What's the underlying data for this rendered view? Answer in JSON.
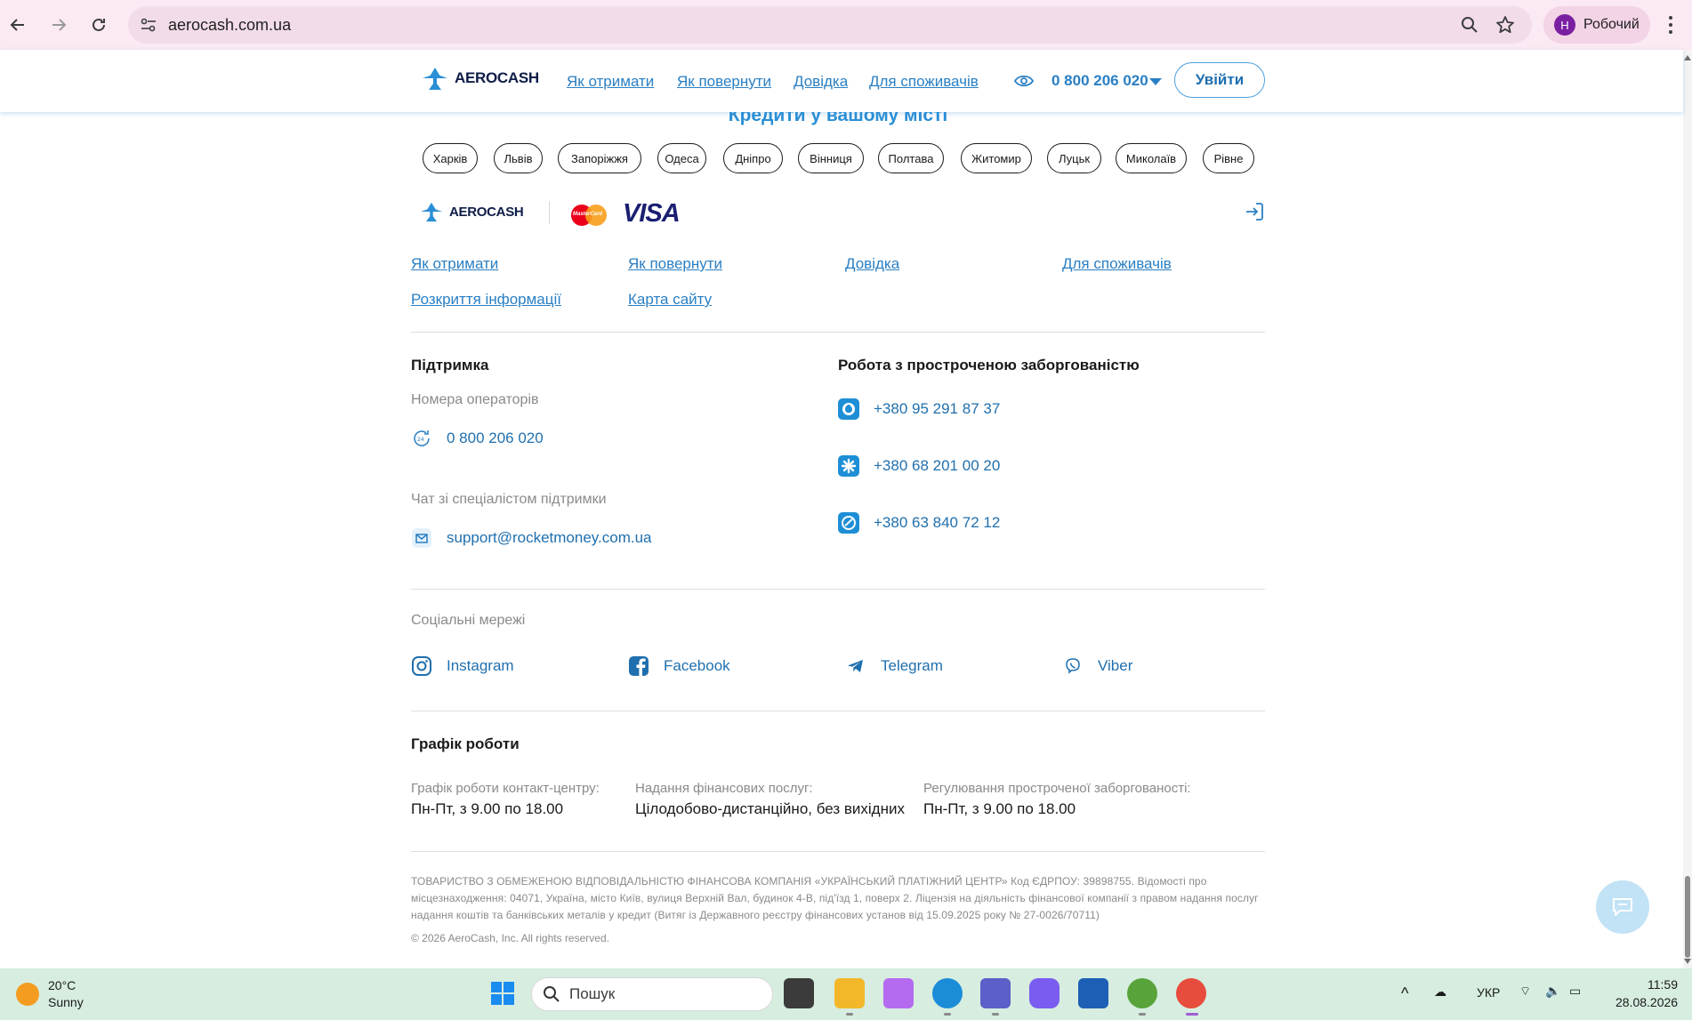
{
  "browser": {
    "url": "aerocash.com.ua",
    "profile_initial": "Н",
    "profile_name": "Робочий"
  },
  "header": {
    "logo_text": "AEROCASH",
    "nav": [
      "Як отримати",
      "Як повернути",
      "Довідка",
      "Для споживачів"
    ],
    "phone": "0 800 206 020",
    "login_label": "Увійти"
  },
  "cities": {
    "title": "Кредити у вашому місті",
    "items": [
      "Харків",
      "Львів",
      "Запоріжжя",
      "Одеса",
      "Дніпро",
      "Вінниця",
      "Полтава",
      "Житомир",
      "Луцьк",
      "Миколаїв",
      "Рівне"
    ]
  },
  "footer": {
    "logo_text": "AEROCASH",
    "mastercard_text": "MasterCard",
    "visa_text": "VISA",
    "links": [
      "Як отримати",
      "Як повернути",
      "Довідка",
      "Для споживачів",
      "Розкриття інформації",
      "Карта сайту"
    ],
    "support": {
      "title": "Підтримка",
      "operators_label": "Номера операторів",
      "phone": "0 800 206 020",
      "chat_label": "Чат зі спеціалістом підтримки",
      "email": "support@rocketmoney.com.ua"
    },
    "debt": {
      "title": "Робота з простроченою заборгованістю",
      "phones": [
        "+380 95 291 87 37",
        "+380 68 201 00 20",
        "+380 63 840 72 12"
      ]
    },
    "social": {
      "label": "Соціальні мережі",
      "items": [
        "Instagram",
        "Facebook",
        "Telegram",
        "Viber"
      ]
    },
    "schedule": {
      "title": "Графік роботи",
      "items": [
        {
          "label": "Графік роботи контакт-центру:",
          "value": "Пн-Пт, з 9.00 по 18.00"
        },
        {
          "label": "Надання фінансових послуг:",
          "value": "Цілодобово-дистанційно, без вихідних"
        },
        {
          "label": "Регулювання простроченої заборгованості:",
          "value": "Пн-Пт, з 9.00 по 18.00"
        }
      ]
    },
    "legal": "ТОВАРИСТВО З ОБМЕЖЕНОЮ ВІДПОВІДАЛЬНІСТЮ ФІНАНСОВА КОМПАНІЯ «УКРАЇНСЬКИЙ ПЛАТІЖНИЙ ЦЕНТР» Код ЄДРПОУ: 39898755. Відомості про місцезнаходження: 04071, Україна, місто Київ, вулиця Верхній Вал, будинок 4-В, під'їзд 1, поверх 2. Ліцензія на діяльність фінансової компанії з правом надання послуг надання коштів та банківських металів у кредит (Витяг із Державного реєстру фінансових установ від 15.09.2025 року № 27-0026/70711)",
    "copyright": "© 2026 AeroCash, Inc. All rights reserved."
  },
  "taskbar": {
    "temp": "20°C",
    "weather": "Sunny",
    "search_placeholder": "Пошук",
    "lang": "УКР",
    "time": "11:59",
    "date": "28.08.2026"
  },
  "colors": {
    "brand_blue": "#2a7fc3",
    "brand_navy": "#0e1d48",
    "chrome_bg": "#fbe9f3",
    "taskbar_bg": "#d6ede0"
  }
}
